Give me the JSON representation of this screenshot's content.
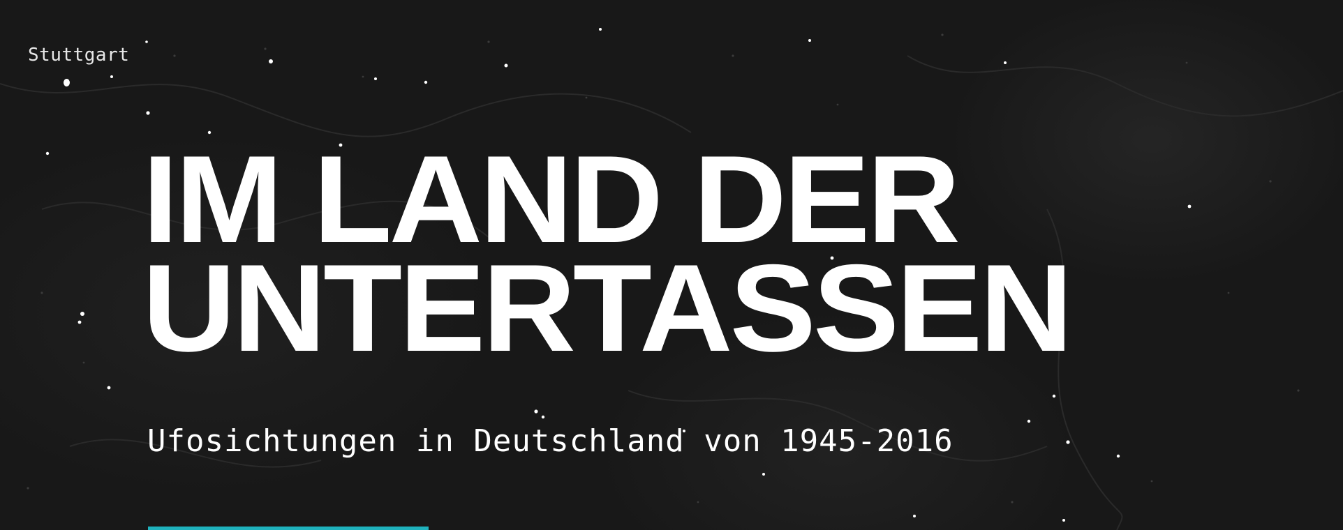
{
  "map": {
    "city_label": "Stuttgart"
  },
  "hero": {
    "title_line1": "IM LAND DER",
    "title_line2": "UNTERTASSEN",
    "subtitle": "Ufosichtungen in Deutschland von 1945-2016"
  },
  "colors": {
    "background": "#181818",
    "text": "#ffffff",
    "accent": "#1fb2bd"
  }
}
